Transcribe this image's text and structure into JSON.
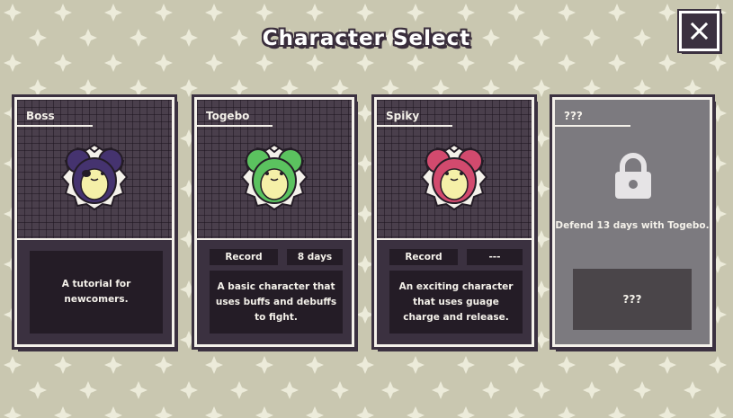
{
  "screen": {
    "title": "Character Select"
  },
  "close_icon": "close-icon",
  "colors": {
    "background": "#c9c7b0",
    "panel": "#3b3140",
    "boss": "#45336f",
    "togebo": "#5bc25f",
    "spiky": "#d24a6e",
    "locked": "#7c7a7f"
  },
  "cards": [
    {
      "name": "Boss",
      "description": "A tutorial for newcomers."
    },
    {
      "name": "Togebo",
      "record_label": "Record",
      "record_value": "8 days",
      "description": "A basic character that uses buffs and debuffs to fight."
    },
    {
      "name": "Spiky",
      "record_label": "Record",
      "record_value": "---",
      "description": "An exciting character that uses guage charge and release."
    },
    {
      "name": "???",
      "unlock_hint": "Defend 13 days with Togebo.",
      "locked_text": "???",
      "icon": "lock-icon"
    }
  ]
}
